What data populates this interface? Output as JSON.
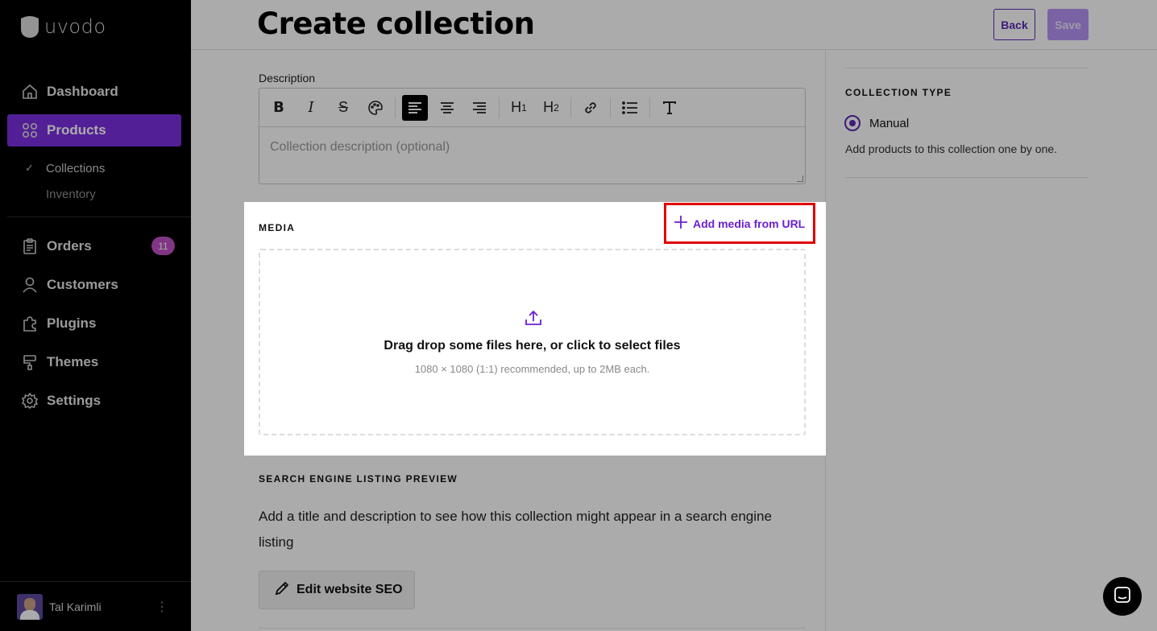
{
  "brand": {
    "name": "uvodo"
  },
  "nav": {
    "items": [
      {
        "label": "Dashboard",
        "icon": "home-icon"
      },
      {
        "label": "Products",
        "icon": "grid-icon",
        "active": true
      },
      {
        "label": "Orders",
        "icon": "clipboard-icon",
        "badge": "11"
      },
      {
        "label": "Customers",
        "icon": "user-icon"
      },
      {
        "label": "Plugins",
        "icon": "puzzle-icon"
      },
      {
        "label": "Themes",
        "icon": "paint-roller-icon"
      },
      {
        "label": "Settings",
        "icon": "gear-icon"
      }
    ],
    "sub_items": [
      {
        "label": "Collections",
        "selected": true
      },
      {
        "label": "Inventory"
      }
    ]
  },
  "user": {
    "name": "Tal Karimli"
  },
  "header": {
    "title": "Create collection",
    "back_label": "Back",
    "save_label": "Save"
  },
  "description": {
    "label": "Description",
    "placeholder": "Collection description (optional)"
  },
  "media": {
    "label": "MEDIA",
    "add_url_label": "Add media from URL",
    "drop_title": "Drag drop some files here, or click to select files",
    "drop_subtitle": "1080 × 1080 (1:1) recommended, up to 2MB each."
  },
  "seo": {
    "label": "SEARCH ENGINE LISTING PREVIEW",
    "description": "Add a title and description to see how this collection might appear in a search engine listing",
    "edit_label": "Edit website SEO"
  },
  "collection_type": {
    "label": "COLLECTION TYPE",
    "option": "Manual",
    "help": "Add products to this collection one by one."
  },
  "colors": {
    "accent": "#7b2fe0",
    "highlight": "#e00000"
  }
}
